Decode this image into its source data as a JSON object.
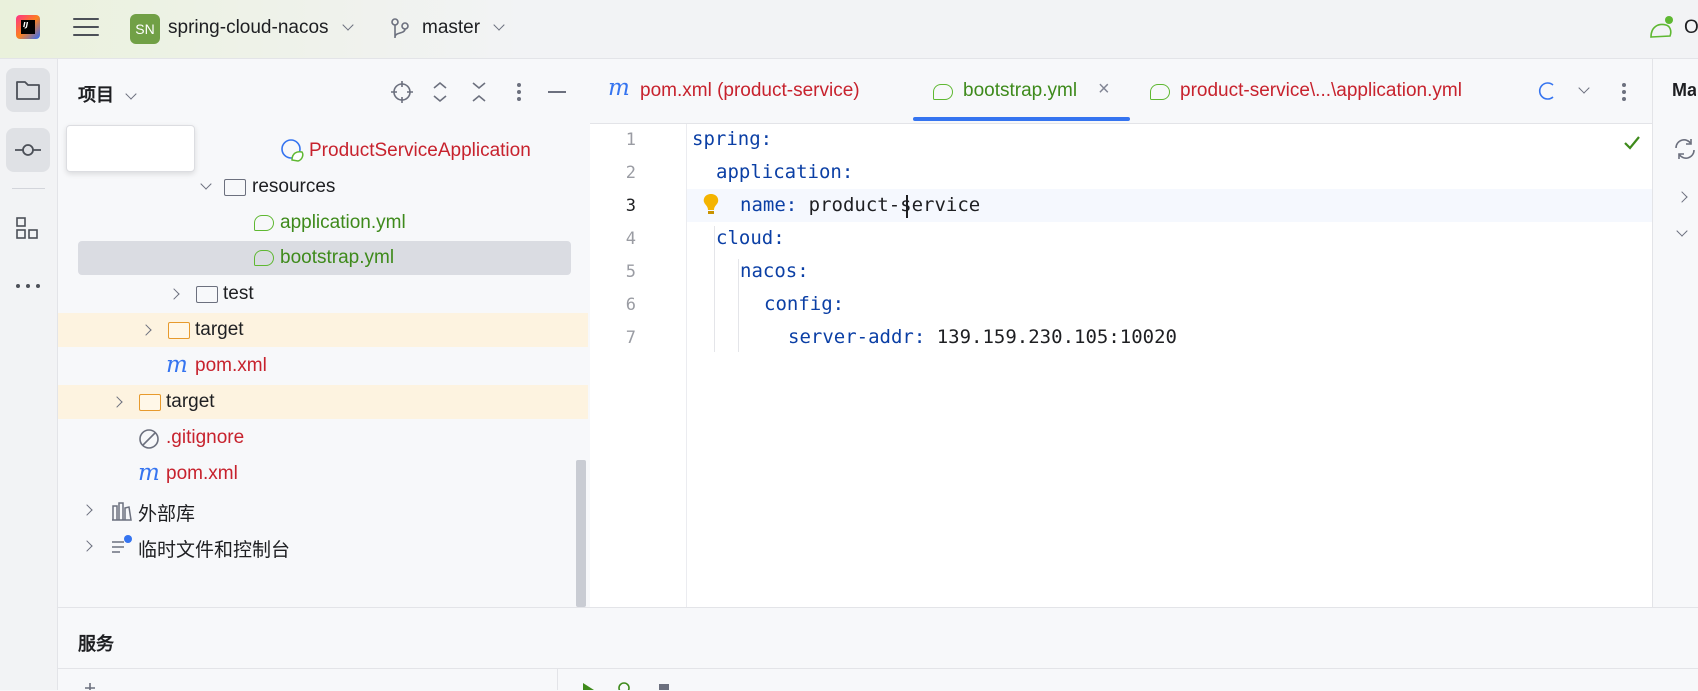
{
  "topbar": {
    "app_icon": "intellij-idea-icon",
    "project_badge": "SN",
    "project_name": "spring-cloud-nacos",
    "branch": "master",
    "right_text": "O"
  },
  "project_panel": {
    "title": "项目",
    "tree": [
      {
        "label": "ProductServiceApplication",
        "icon": "spring-class-icon",
        "color": "#c7222d"
      },
      {
        "label": "resources",
        "icon": "resources-folder-icon"
      },
      {
        "label": "application.yml",
        "icon": "spring-leaf-icon",
        "color": "#3e8a1b"
      },
      {
        "label": "bootstrap.yml",
        "icon": "spring-leaf-icon",
        "color": "#3e8a1b",
        "selected": true
      },
      {
        "label": "test",
        "icon": "folder-icon"
      },
      {
        "label": "target",
        "icon": "folder-orange-icon"
      },
      {
        "label": "pom.xml",
        "icon": "maven-icon",
        "color": "#c7222d"
      },
      {
        "label": "target",
        "icon": "folder-orange-icon"
      },
      {
        "label": ".gitignore",
        "icon": "ignore-icon",
        "color": "#c7222d"
      },
      {
        "label": "pom.xml",
        "icon": "maven-icon",
        "color": "#c7222d"
      },
      {
        "label": "外部库",
        "icon": "library-icon"
      },
      {
        "label": "临时文件和控制台",
        "icon": "scratch-icon"
      }
    ]
  },
  "tabs": [
    {
      "label": "pom.xml (product-service)",
      "icon": "maven-icon"
    },
    {
      "label": "bootstrap.yml",
      "icon": "spring-leaf-icon",
      "active": true
    },
    {
      "label": "product-service\\...\\application.yml",
      "icon": "spring-leaf-icon"
    }
  ],
  "editor": {
    "line_numbers": [
      "1",
      "2",
      "3",
      "4",
      "5",
      "6",
      "7"
    ],
    "lines": [
      {
        "key": "spring",
        "value": ""
      },
      {
        "key": "application",
        "value": ""
      },
      {
        "key": "name",
        "value": "product-service"
      },
      {
        "key": "cloud",
        "value": ""
      },
      {
        "key": "nacos",
        "value": ""
      },
      {
        "key": "config",
        "value": ""
      },
      {
        "key": "server-addr",
        "value": "139.159.230.105:10020"
      }
    ]
  },
  "right_panel": {
    "label": "Ma"
  },
  "bottom": {
    "title": "服务"
  },
  "colors": {
    "accent": "#3574f0",
    "spring_green": "#5fb832",
    "error_red": "#c7222d"
  }
}
